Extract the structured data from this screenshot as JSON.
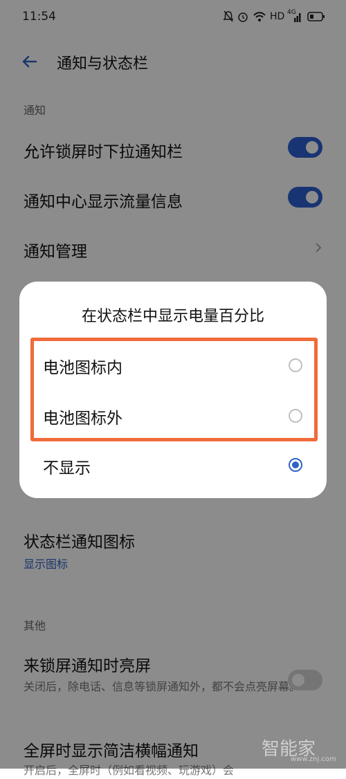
{
  "status_bar": {
    "time": "11:54",
    "hd": "HD",
    "signal_text": "4G"
  },
  "header": {
    "title": "通知与状态栏"
  },
  "sections": {
    "notification": "通知",
    "other": "其他"
  },
  "rows": {
    "lock_pull": {
      "label": "允许锁屏时下拉通知栏",
      "on": true
    },
    "traffic": {
      "label": "通知中心显示流量信息",
      "on": true
    },
    "manage": {
      "label": "通知管理"
    },
    "status_icon": {
      "label": "状态栏通知图标",
      "value": "显示图标"
    },
    "wake": {
      "label": "来锁屏通知时亮屏",
      "desc": "关闭后，除电话、信息等锁屏通知外，都不会点亮屏幕。",
      "on": false
    },
    "banner": {
      "label": "全屏时显示简洁横幅通知",
      "desc": "开启后，全屏时（例如看视频、玩游戏）会"
    }
  },
  "dialog": {
    "title": "在状态栏中显示电量百分比",
    "options": [
      {
        "label": "电池图标内",
        "selected": false
      },
      {
        "label": "电池图标外",
        "selected": false
      },
      {
        "label": "不显示",
        "selected": true
      }
    ]
  },
  "watermark": {
    "text": "智能家",
    "url": "www.znj.com"
  },
  "colors": {
    "accent": "#2f63c5",
    "highlight": "#f06a3a"
  }
}
